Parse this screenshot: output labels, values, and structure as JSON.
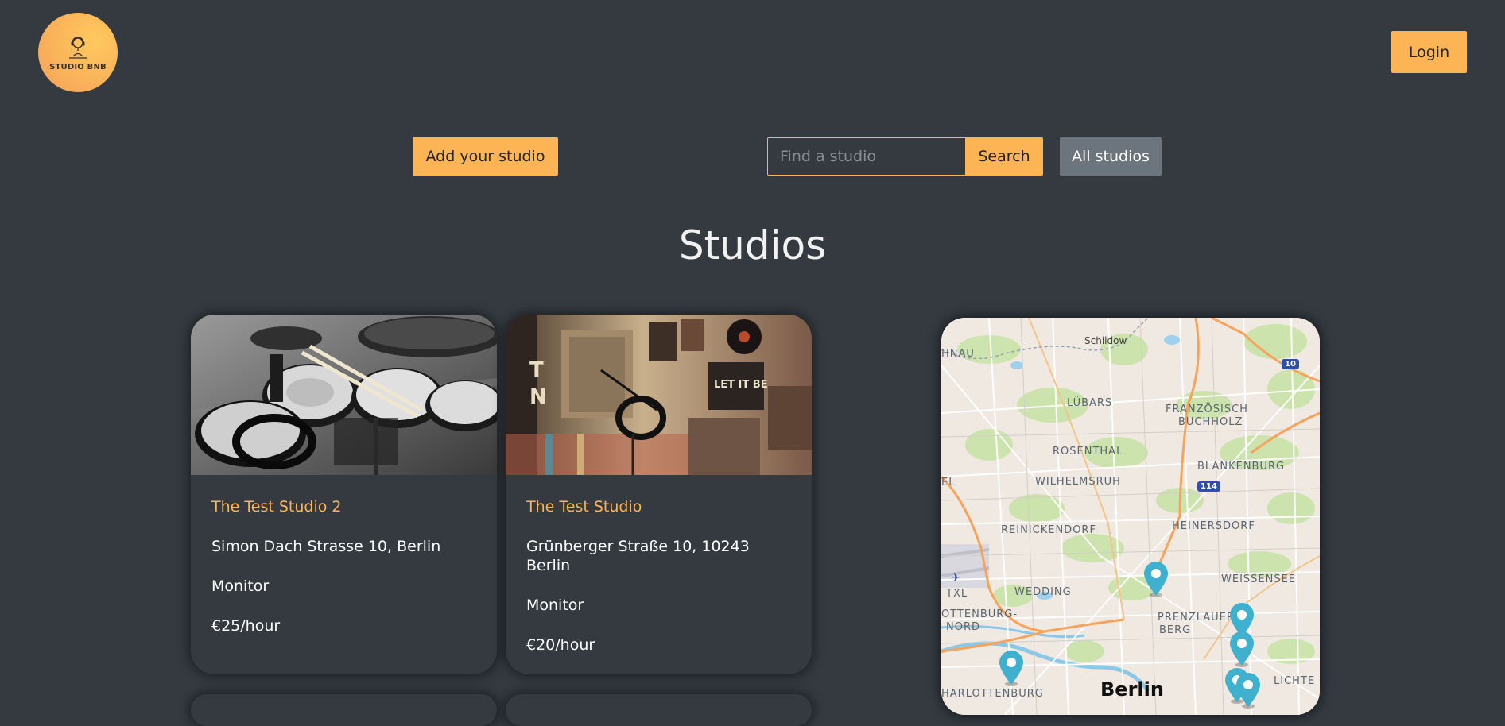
{
  "header": {
    "logo_text": "STUDIO BNB",
    "login_label": "Login"
  },
  "toolbar": {
    "add_label": "Add your studio",
    "search_placeholder": "Find a studio",
    "search_value": "",
    "search_label": "Search",
    "all_label": "All studios"
  },
  "main": {
    "title": "Studios",
    "cards": [
      {
        "title": "The Test Studio 2",
        "address": "Simon Dach Strasse 10, Berlin",
        "equipment": "Monitor",
        "price": "€25/hour",
        "image": "drum-kit-photo"
      },
      {
        "title": "The Test Studio",
        "address": "Grünberger Straße 10, 10243 Berlin",
        "equipment": "Monitor",
        "price": "€20/hour",
        "image": "studio-wall-photo"
      }
    ]
  },
  "map": {
    "labels": {
      "schildow": "Schildow",
      "hnau": "HNAU",
      "lubars": "LÜBARS",
      "franz1": "FRANZÖSISCH",
      "franz2": "BUCHHOLZ",
      "rosenthal": "ROSENTHAL",
      "blankenburg": "BLANKENBURG",
      "wilhelmsruh": "WILHELMSRUH",
      "reinickendorf": "REINICKENDORF",
      "heinersdorf": "HEINERSDORF",
      "weissensee": "WEISSENSEE",
      "txl": "TXL",
      "wedding": "WEDDING",
      "prenz1": "PRENZLAUER",
      "prenz2": "BERG",
      "ottenburg1": "OTTENBURG-",
      "ottenburg2": "NORD",
      "charlottenburg": "HARLOTTENBURG",
      "berlin": "Berlin",
      "lichte": "LICHTE",
      "el": "EL"
    },
    "road_badges": [
      "10",
      "114"
    ],
    "marker_color": "#3fb1ce",
    "marker_count": 6
  },
  "colors": {
    "background": "#343a40",
    "accent": "#fcb455",
    "secondary": "#6c757d"
  }
}
